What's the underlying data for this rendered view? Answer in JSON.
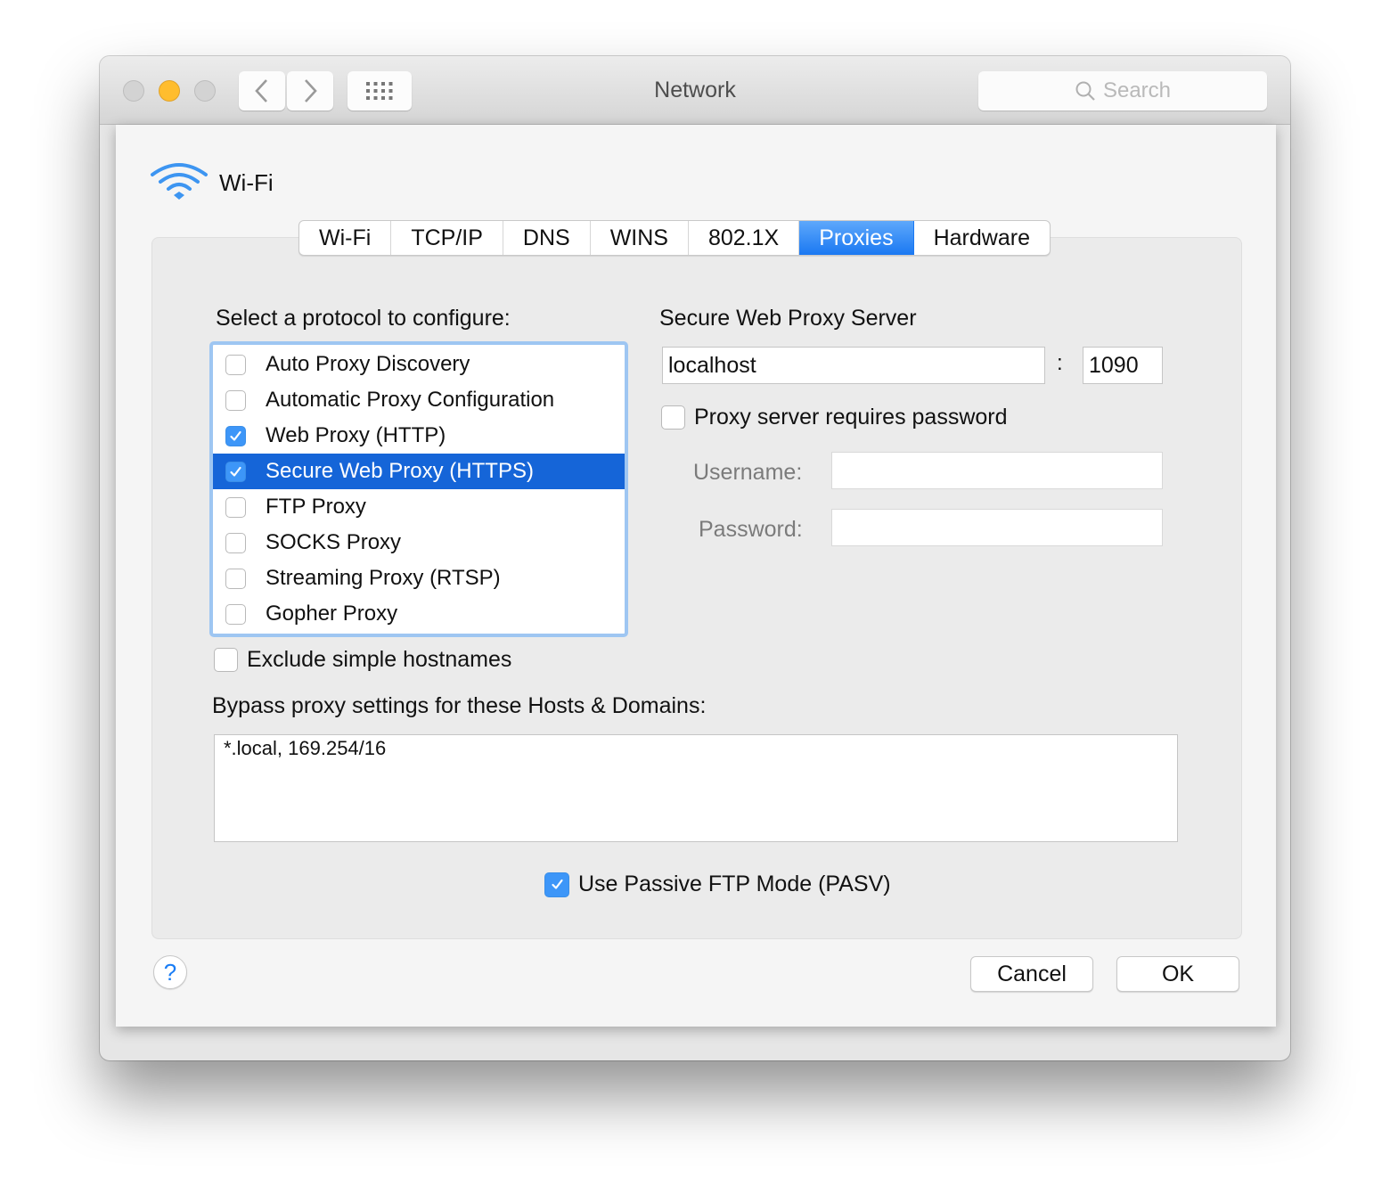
{
  "window": {
    "title": "Network",
    "search_placeholder": "Search",
    "nav": {
      "back": "back",
      "forward": "forward",
      "show_all": "show-all"
    }
  },
  "sheet": {
    "interface_name": "Wi-Fi",
    "tabs": [
      {
        "label": "Wi-Fi",
        "active": false
      },
      {
        "label": "TCP/IP",
        "active": false
      },
      {
        "label": "DNS",
        "active": false
      },
      {
        "label": "WINS",
        "active": false
      },
      {
        "label": "802.1X",
        "active": false
      },
      {
        "label": "Proxies",
        "active": true
      },
      {
        "label": "Hardware",
        "active": false
      }
    ],
    "protocol_heading": "Select a protocol to configure:",
    "protocols": [
      {
        "label": "Auto Proxy Discovery",
        "checked": false,
        "selected": false
      },
      {
        "label": "Automatic Proxy Configuration",
        "checked": false,
        "selected": false
      },
      {
        "label": "Web Proxy (HTTP)",
        "checked": true,
        "selected": false
      },
      {
        "label": "Secure Web Proxy (HTTPS)",
        "checked": true,
        "selected": true
      },
      {
        "label": "FTP Proxy",
        "checked": false,
        "selected": false
      },
      {
        "label": "SOCKS Proxy",
        "checked": false,
        "selected": false
      },
      {
        "label": "Streaming Proxy (RTSP)",
        "checked": false,
        "selected": false
      },
      {
        "label": "Gopher Proxy",
        "checked": false,
        "selected": false
      }
    ],
    "server": {
      "heading": "Secure Web Proxy Server",
      "host": "localhost",
      "separator": ":",
      "port": "1090",
      "requires_password_label": "Proxy server requires password",
      "requires_password": false,
      "username_label": "Username:",
      "username": "",
      "password_label": "Password:",
      "password": ""
    },
    "exclude_simple_hostnames": {
      "label": "Exclude simple hostnames",
      "checked": false
    },
    "bypass": {
      "label": "Bypass proxy settings for these Hosts & Domains:",
      "value": "*.local, 169.254/16"
    },
    "passive_ftp": {
      "label": "Use Passive FTP Mode (PASV)",
      "checked": true
    },
    "help_label": "?",
    "cancel_label": "Cancel",
    "ok_label": "OK"
  },
  "colors": {
    "accent": "#1a78f2",
    "selection": "#1565d8",
    "checkbox_checked": "#3d96f8",
    "minimize": "#ffbd2e",
    "focus_ring": "#9ec6f2"
  }
}
